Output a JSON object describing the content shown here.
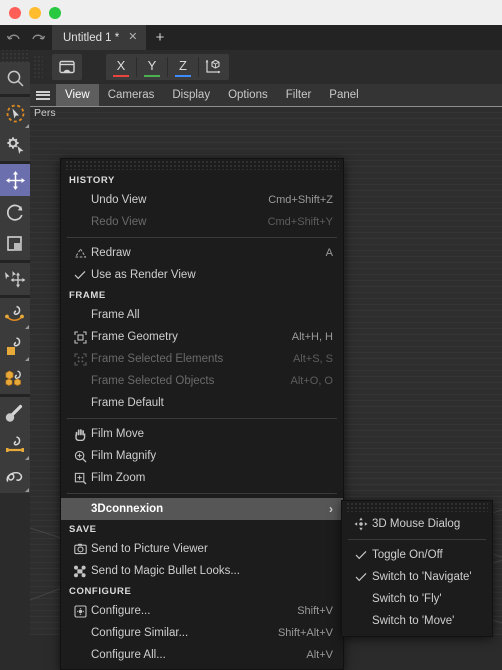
{
  "window": {
    "traffic_lights": [
      "close",
      "minimize",
      "zoom"
    ]
  },
  "tabbar": {
    "undo_icon": "undo-arrow-icon",
    "redo_icon": "redo-arrow-icon",
    "tab_title": "Untitled 1 *",
    "tab_close": "✕",
    "new_tab": "+"
  },
  "axis_toolbar": {
    "render_view_icon": "render-view-icon",
    "axes": [
      {
        "label": "X",
        "color": "#e8453c"
      },
      {
        "label": "Y",
        "color": "#4caf50"
      },
      {
        "label": "Z",
        "color": "#3d8bfd"
      }
    ],
    "world_axis_icon": "world-object-axis-icon"
  },
  "menubar": {
    "hamburger_icon": "hamburger-menu-icon",
    "items": [
      {
        "label": "View",
        "selected": true
      },
      {
        "label": "Cameras",
        "selected": false
      },
      {
        "label": "Display",
        "selected": false
      },
      {
        "label": "Options",
        "selected": false
      },
      {
        "label": "Filter",
        "selected": false
      },
      {
        "label": "Panel",
        "selected": false
      }
    ]
  },
  "viewport": {
    "label": "Pers"
  },
  "left_toolbar": {
    "tools": [
      {
        "name": "search-tool",
        "icon": "magnifier-icon",
        "active": false,
        "corner": false
      },
      {
        "name": "live-selection-tool",
        "icon": "live-selection-icon",
        "active": false,
        "corner": true
      },
      {
        "name": "tool-settings",
        "icon": "gear-cursor-icon",
        "active": false,
        "corner": false
      },
      {
        "name": "move-tool",
        "icon": "move-arrows-icon",
        "active": true,
        "corner": false
      },
      {
        "name": "rotate-tool",
        "icon": "rotate-arc-icon",
        "active": false,
        "corner": false
      },
      {
        "name": "scale-tool",
        "icon": "scale-squares-icon",
        "active": false,
        "corner": false
      },
      {
        "name": "axis-move-tool",
        "icon": "axis-move-icon",
        "active": false,
        "corner": false
      },
      {
        "name": "spline-pen-tool",
        "icon": "spline-pen-icon",
        "active": false,
        "corner": true
      },
      {
        "name": "primitive-cube-tool",
        "icon": "cube-pen-icon",
        "active": false,
        "corner": true
      },
      {
        "name": "generator-tool",
        "icon": "cubes-pen-icon",
        "active": false,
        "corner": false
      },
      {
        "name": "paint-brush-tool",
        "icon": "brush-icon",
        "active": false,
        "corner": false
      },
      {
        "name": "deformer-tool",
        "icon": "deformer-pen-icon",
        "active": false,
        "corner": true
      },
      {
        "name": "sculpt-spline-tool",
        "icon": "spline-curve-icon",
        "active": false,
        "corner": true
      }
    ]
  },
  "view_menu": {
    "groups": [
      {
        "header": "HISTORY",
        "items": [
          {
            "label": "Undo View",
            "shortcut": "Cmd+Shift+Z",
            "icon": "",
            "check": false,
            "disabled": false,
            "submenu": false,
            "highlight": false
          },
          {
            "label": "Redo View",
            "shortcut": "Cmd+Shift+Y",
            "icon": "",
            "check": false,
            "disabled": true,
            "submenu": false,
            "highlight": false
          }
        ]
      },
      {
        "header": "",
        "separator_before": true,
        "items": [
          {
            "label": "Redraw",
            "shortcut": "A",
            "icon": "redraw-icon",
            "check": false,
            "disabled": false,
            "submenu": false,
            "highlight": false
          },
          {
            "label": "Use as Render View",
            "shortcut": "",
            "icon": "check-icon",
            "check": true,
            "disabled": false,
            "submenu": false,
            "highlight": false
          }
        ]
      },
      {
        "header": "FRAME",
        "items": [
          {
            "label": "Frame All",
            "shortcut": "",
            "icon": "",
            "check": false,
            "disabled": false,
            "submenu": false,
            "highlight": false
          },
          {
            "label": "Frame Geometry",
            "shortcut": "Alt+H, H",
            "icon": "frame-geometry-icon",
            "check": false,
            "disabled": false,
            "submenu": false,
            "highlight": false
          },
          {
            "label": "Frame Selected Elements",
            "shortcut": "Alt+S, S",
            "icon": "frame-elements-icon",
            "check": false,
            "disabled": true,
            "submenu": false,
            "highlight": false
          },
          {
            "label": "Frame Selected Objects",
            "shortcut": "Alt+O, O",
            "icon": "",
            "check": false,
            "disabled": true,
            "submenu": false,
            "highlight": false
          },
          {
            "label": "Frame Default",
            "shortcut": "",
            "icon": "",
            "check": false,
            "disabled": false,
            "submenu": false,
            "highlight": false
          }
        ]
      },
      {
        "header": "",
        "separator_before": true,
        "items": [
          {
            "label": "Film Move",
            "shortcut": "",
            "icon": "hand-icon",
            "check": false,
            "disabled": false,
            "submenu": false,
            "highlight": false
          },
          {
            "label": "Film Magnify",
            "shortcut": "",
            "icon": "magnify-plus-icon",
            "check": false,
            "disabled": false,
            "submenu": false,
            "highlight": false
          },
          {
            "label": "Film Zoom",
            "shortcut": "",
            "icon": "zoom-box-icon",
            "check": false,
            "disabled": false,
            "submenu": false,
            "highlight": false
          }
        ]
      },
      {
        "header": "",
        "separator_before": true,
        "items": [
          {
            "label": "3Dconnexion",
            "shortcut": "",
            "icon": "",
            "check": false,
            "disabled": false,
            "submenu": true,
            "highlight": true
          }
        ]
      },
      {
        "header": "SAVE",
        "items": [
          {
            "label": "Send to Picture Viewer",
            "shortcut": "",
            "icon": "camera-icon",
            "check": false,
            "disabled": false,
            "submenu": false,
            "highlight": false
          },
          {
            "label": "Send to Magic Bullet Looks...",
            "shortcut": "",
            "icon": "magic-bullet-icon",
            "check": false,
            "disabled": false,
            "submenu": false,
            "highlight": false
          }
        ]
      },
      {
        "header": "CONFIGURE",
        "items": [
          {
            "label": "Configure...",
            "shortcut": "Shift+V",
            "icon": "configure-icon",
            "check": false,
            "disabled": false,
            "submenu": false,
            "highlight": false
          },
          {
            "label": "Configure Similar...",
            "shortcut": "Shift+Alt+V",
            "icon": "",
            "check": false,
            "disabled": false,
            "submenu": false,
            "highlight": false
          },
          {
            "label": "Configure All...",
            "shortcut": "Alt+V",
            "icon": "",
            "check": false,
            "disabled": false,
            "submenu": false,
            "highlight": false
          }
        ]
      }
    ]
  },
  "connexion_submenu": {
    "items": [
      {
        "label": "3D Mouse Dialog",
        "icon": "3d-mouse-icon",
        "check": false,
        "separator_after": true
      },
      {
        "label": "Toggle On/Off",
        "icon": "check-icon",
        "check": true,
        "separator_after": false
      },
      {
        "label": "Switch to 'Navigate'",
        "icon": "check-icon",
        "check": true,
        "separator_after": false
      },
      {
        "label": "Switch to 'Fly'",
        "icon": "",
        "check": false,
        "separator_after": false
      },
      {
        "label": "Switch to 'Move'",
        "icon": "",
        "check": false,
        "separator_after": false
      }
    ]
  }
}
